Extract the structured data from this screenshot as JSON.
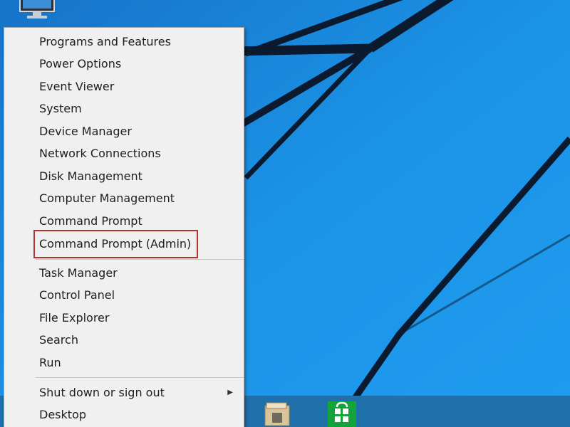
{
  "menu": {
    "groups": [
      {
        "items": [
          {
            "label": "Programs and Features"
          },
          {
            "label": "Power Options"
          },
          {
            "label": "Event Viewer"
          },
          {
            "label": "System"
          },
          {
            "label": "Device Manager"
          },
          {
            "label": "Network Connections"
          },
          {
            "label": "Disk Management"
          },
          {
            "label": "Computer Management"
          },
          {
            "label": "Command Prompt"
          },
          {
            "label": "Command Prompt (Admin)",
            "highlighted": true
          }
        ]
      },
      {
        "items": [
          {
            "label": "Task Manager"
          },
          {
            "label": "Control Panel"
          },
          {
            "label": "File Explorer"
          },
          {
            "label": "Search"
          },
          {
            "label": "Run"
          }
        ]
      },
      {
        "items": [
          {
            "label": "Shut down or sign out",
            "has_submenu": true
          },
          {
            "label": "Desktop"
          }
        ]
      }
    ],
    "highlight_color": "#b2332f"
  },
  "desktop": {
    "wallpaper_color": "#1a8fe0",
    "icons": [
      "computer-icon"
    ]
  },
  "taskbar": {
    "color": "#1f6faa",
    "buttons": [
      "file-explorer-icon",
      "store-icon"
    ],
    "store_color": "#12a33a"
  }
}
